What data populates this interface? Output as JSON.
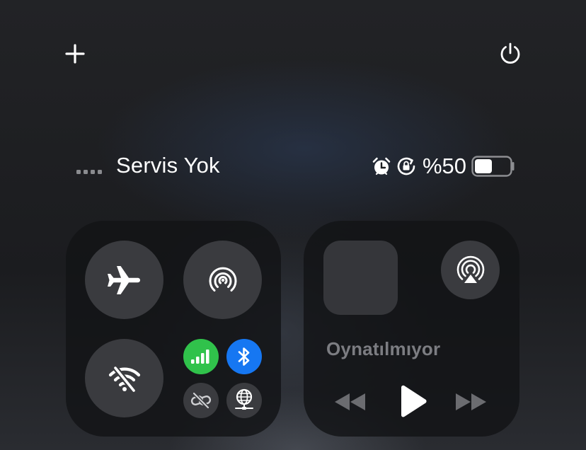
{
  "top_bar": {
    "add_icon": "plus-icon",
    "power_icon": "power-icon"
  },
  "status_bar": {
    "signal_bars": 4,
    "carrier_text": "Servis Yok",
    "alarm_icon": "alarm-clock-icon",
    "rotation_lock_icon": "rotation-lock-icon",
    "battery_percent": "%50",
    "battery_level": 0.5
  },
  "connectivity": {
    "airplane_mode": {
      "icon": "airplane-icon",
      "on": false
    },
    "airdrop": {
      "icon": "airdrop-icon",
      "on": false
    },
    "wifi": {
      "icon": "wifi-off-icon",
      "on": false
    },
    "cellular": {
      "icon": "cellular-bars-icon",
      "on": true,
      "color": "#30c24b"
    },
    "bluetooth": {
      "icon": "bluetooth-icon",
      "on": true,
      "color": "#1677f2"
    },
    "personal_hotspot": {
      "icon": "hotspot-link-icon",
      "on": false
    },
    "vpn": {
      "icon": "vpn-globe-icon",
      "on": false
    }
  },
  "now_playing": {
    "title": "Oynatılmıyor",
    "airplay_icon": "airplay-audio-icon",
    "controls": {
      "previous": "rewind-icon",
      "play": "play-icon",
      "next": "fast-forward-icon"
    }
  }
}
